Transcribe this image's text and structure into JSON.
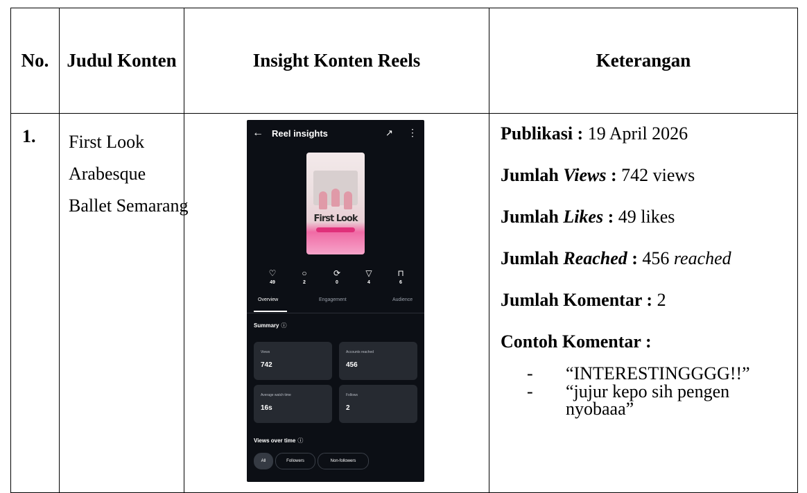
{
  "table": {
    "headers": {
      "no": "No.",
      "title": "Judul Konten",
      "insight": "Insight Konten Reels",
      "keterangan": "Keterangan"
    },
    "row": {
      "no": "1.",
      "title_lines": [
        "First Look",
        "Arabesque",
        "Ballet Semarang"
      ],
      "keterangan": {
        "publikasi_label": "Publikasi :",
        "publikasi_value": " 19 April 2026",
        "views_label": "Jumlah ",
        "views_italic": "Views",
        "views_colon": " :",
        "views_value": " 742 views",
        "likes_label": "Jumlah ",
        "likes_italic": "Likes",
        "likes_colon": " :",
        "likes_value": " 49 likes",
        "reached_label": "Jumlah ",
        "reached_italic": "Reached",
        "reached_colon": " :",
        "reached_value_num": " 456 ",
        "reached_value_word": "reached",
        "komentar_label": "Jumlah Komentar :",
        "komentar_value": " 2",
        "contoh_label": "Contoh Komentar :",
        "comments": [
          {
            "dash": "-",
            "text": "“INTERESTINGGGG!!”"
          },
          {
            "dash": "-",
            "text": "“jujur kepo sih pengen nyobaaa”"
          }
        ]
      }
    }
  },
  "phone": {
    "back_icon": "←",
    "title": "Reel insights",
    "trend_icon": "↗",
    "more_icon": "⋮",
    "thumbnail_text": "First Look",
    "stats": [
      {
        "icon": "♡",
        "icon_name": "heart-icon",
        "value": "49"
      },
      {
        "icon": "○",
        "icon_name": "comment-icon",
        "value": "2"
      },
      {
        "icon": "⟳",
        "icon_name": "repost-icon",
        "value": "0"
      },
      {
        "icon": "▽",
        "icon_name": "share-icon",
        "value": "4"
      },
      {
        "icon": "⊓",
        "icon_name": "save-icon",
        "value": "6"
      }
    ],
    "tabs": [
      "Overview",
      "Engagement",
      "Audience"
    ],
    "summary_title": "Summary",
    "info_icon": "ⓘ",
    "cards": [
      {
        "label": "Views",
        "value": "742"
      },
      {
        "label": "Accounts reached",
        "value": "456"
      },
      {
        "label": "Average watch time",
        "value": "16s"
      },
      {
        "label": "Follows",
        "value": "2"
      }
    ],
    "views_over_time_title": "Views over time",
    "chips": [
      "All",
      "Followers",
      "Non-followers"
    ],
    "colors": {
      "background": "#0c0f15",
      "card": "#262a31",
      "accent_pink": "#f06ba5"
    }
  }
}
